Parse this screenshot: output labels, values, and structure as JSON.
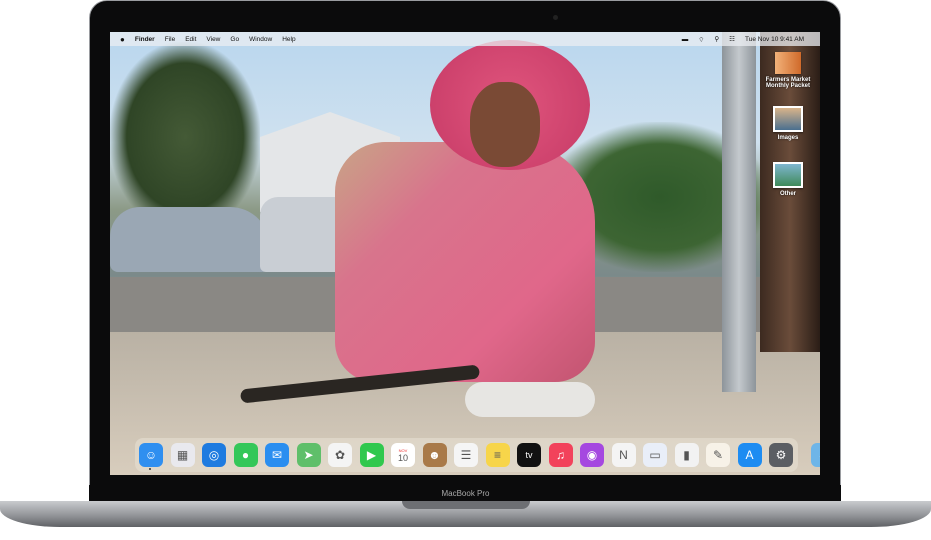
{
  "menubar": {
    "apple": "",
    "app": "Finder",
    "items": [
      "File",
      "Edit",
      "View",
      "Go",
      "Window",
      "Help"
    ],
    "clock": "Tue Nov 10  9:41 AM"
  },
  "desktop_items": [
    {
      "label": "Farmers Market Monthly Packet"
    },
    {
      "label": "Images"
    },
    {
      "label": "Other"
    }
  ],
  "dock": {
    "apps": [
      {
        "name": "finder",
        "color": "#2f8ff0",
        "glyph": "☺"
      },
      {
        "name": "launchpad",
        "color": "#e9e9ee",
        "glyph": "▦"
      },
      {
        "name": "safari",
        "color": "#1e7be0",
        "glyph": "◎"
      },
      {
        "name": "messages",
        "color": "#34c759",
        "glyph": "●"
      },
      {
        "name": "mail",
        "color": "#2a8ef0",
        "glyph": "✉"
      },
      {
        "name": "maps",
        "color": "#5fbf6a",
        "glyph": "➤"
      },
      {
        "name": "photos",
        "color": "#f4f4f4",
        "glyph": "✿"
      },
      {
        "name": "facetime",
        "color": "#30c84e",
        "glyph": "▶"
      },
      {
        "name": "calendar",
        "color": "#ffffff",
        "glyph": "10",
        "month": "NOV"
      },
      {
        "name": "contacts",
        "color": "#a97a49",
        "glyph": "☻"
      },
      {
        "name": "reminders",
        "color": "#f5f5f5",
        "glyph": "☰"
      },
      {
        "name": "notes",
        "color": "#f7d54a",
        "glyph": "≡"
      },
      {
        "name": "apple-tv",
        "color": "#111111",
        "glyph": "tv"
      },
      {
        "name": "music",
        "color": "#f2425b",
        "glyph": "♫"
      },
      {
        "name": "podcasts",
        "color": "#a548e0",
        "glyph": "◉"
      },
      {
        "name": "news",
        "color": "#f4f4f4",
        "glyph": "N"
      },
      {
        "name": "keynote",
        "color": "#e9eef8",
        "glyph": "▭"
      },
      {
        "name": "numbers",
        "color": "#f2f2f2",
        "glyph": "▮"
      },
      {
        "name": "pages",
        "color": "#f7f2e8",
        "glyph": "✎"
      },
      {
        "name": "app-store",
        "color": "#1d8cf2",
        "glyph": "A"
      },
      {
        "name": "system-preferences",
        "color": "#5b5e63",
        "glyph": "⚙"
      }
    ],
    "folder": {
      "color": "#6eb5e8",
      "glyph": "⬇"
    },
    "trash": {
      "color": "#e8eaec",
      "glyph": "🗑"
    }
  },
  "device": {
    "model": "MacBook Pro"
  }
}
